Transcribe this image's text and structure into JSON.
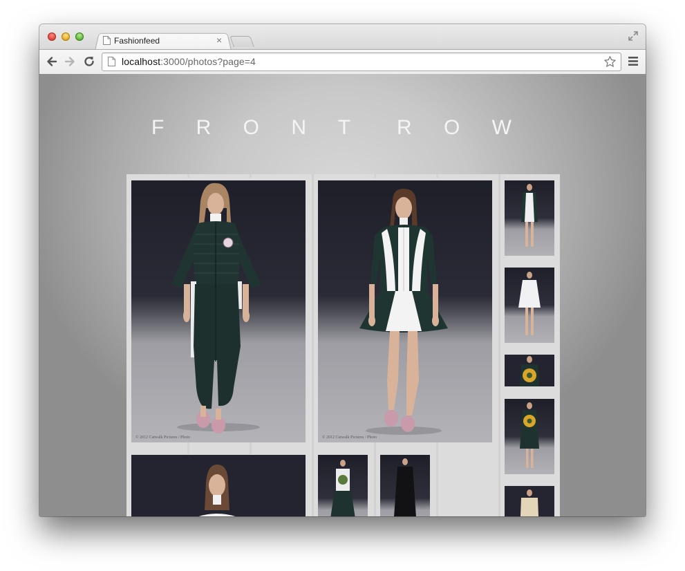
{
  "browser": {
    "tab_title": "Fashionfeed",
    "tab_close": "×",
    "url_host": "localhost",
    "url_rest": ":3000/photos?page=4"
  },
  "page": {
    "title_left": "F R O N T",
    "title_right": "R O W"
  },
  "photos": [
    {
      "id": "large-1",
      "caption": "© 2012 Catwalk Pictures / Photo",
      "outfit": "dark-green quilted jacket and harem trousers"
    },
    {
      "id": "large-2",
      "caption": "© 2012 Catwalk Pictures / Photo",
      "outfit": "dark-green and white fit-and-flare dress"
    },
    {
      "id": "thumb-1"
    },
    {
      "id": "thumb-2"
    },
    {
      "id": "thumb-3"
    },
    {
      "id": "thumb-4"
    },
    {
      "id": "thumb-5"
    },
    {
      "id": "bottom-1"
    },
    {
      "id": "bottom-2"
    },
    {
      "id": "bottom-3"
    }
  ],
  "colors": {
    "backdrop_dark": "#22222c",
    "floor": "#a9a9ad",
    "outfit_green": "#1f3532",
    "skin": "#d9b29a",
    "shoe_pink": "#c99aaa"
  }
}
